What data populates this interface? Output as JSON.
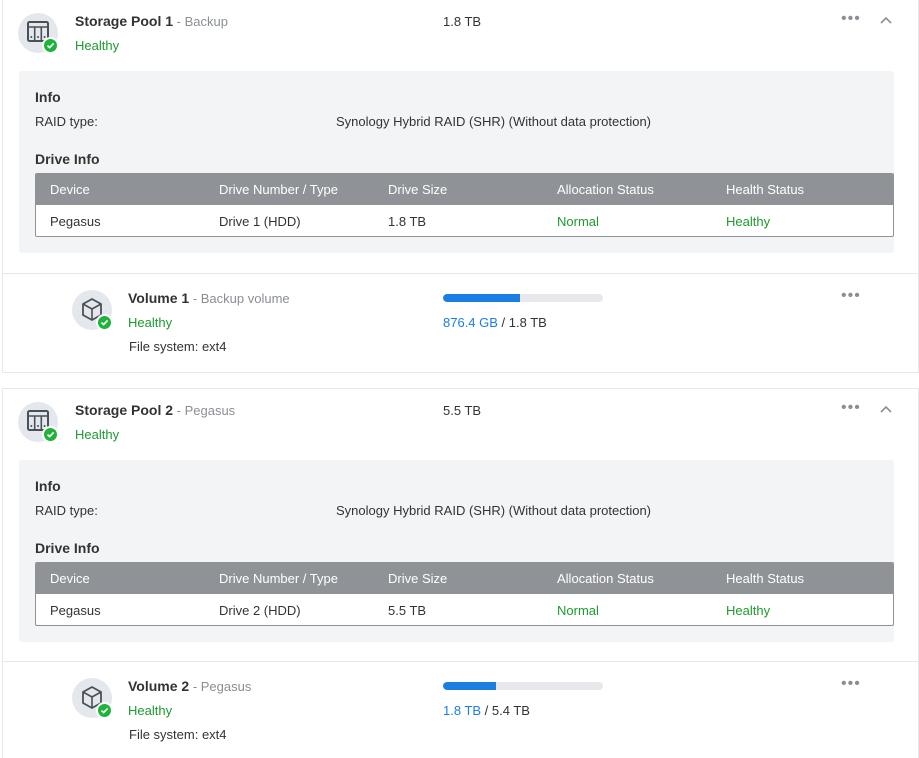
{
  "colors": {
    "healthy": "#1c9b2e",
    "badge": "#1fb33c",
    "accent": "#1b7ee3",
    "table_header": "#8f9398"
  },
  "icons": {
    "pool": "storage-pool-icon",
    "volume": "volume-cube-icon",
    "status": "check-badge-icon",
    "more": "more-dots-icon",
    "collapse": "chevron-up-icon"
  },
  "pools": [
    {
      "title": "Storage Pool 1",
      "subtitle": " - Backup",
      "status": "Healthy",
      "size": "1.8 TB",
      "info_title": "Info",
      "raid_label": "RAID type:",
      "raid_value": "Synology Hybrid RAID (SHR) (Without data protection)",
      "drive_info_title": "Drive Info",
      "table": {
        "headers": [
          "Device",
          "Drive Number / Type",
          "Drive Size",
          "Allocation Status",
          "Health Status"
        ],
        "rows": [
          [
            "Pegasus",
            "Drive 1 (HDD)",
            "1.8 TB",
            "Normal",
            "Healthy"
          ]
        ]
      },
      "volume": {
        "title": "Volume 1",
        "subtitle": " - Backup volume",
        "status": "Healthy",
        "used": "876.4 GB",
        "separator": " / ",
        "total": "1.8 TB",
        "usage_fraction": 0.48,
        "filesystem": "File system: ext4"
      }
    },
    {
      "title": "Storage Pool 2",
      "subtitle": " - Pegasus",
      "status": "Healthy",
      "size": "5.5 TB",
      "info_title": "Info",
      "raid_label": "RAID type:",
      "raid_value": "Synology Hybrid RAID (SHR) (Without data protection)",
      "drive_info_title": "Drive Info",
      "table": {
        "headers": [
          "Device",
          "Drive Number / Type",
          "Drive Size",
          "Allocation Status",
          "Health Status"
        ],
        "rows": [
          [
            "Pegasus",
            "Drive 2 (HDD)",
            "5.5 TB",
            "Normal",
            "Healthy"
          ]
        ]
      },
      "volume": {
        "title": "Volume 2",
        "subtitle": " - Pegasus",
        "status": "Healthy",
        "used": "1.8 TB",
        "separator": " / ",
        "total": "5.4 TB",
        "usage_fraction": 0.33,
        "filesystem": "File system: ext4"
      }
    }
  ]
}
